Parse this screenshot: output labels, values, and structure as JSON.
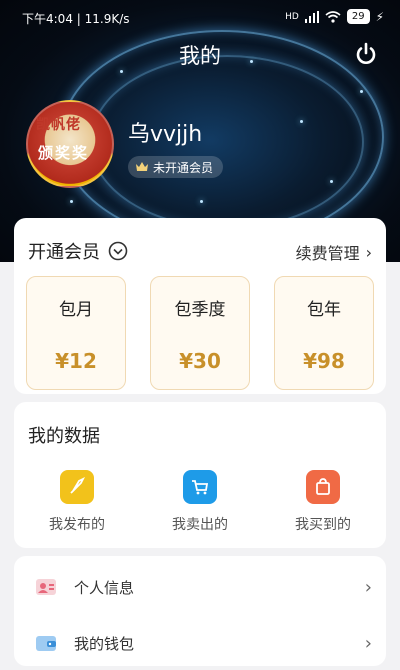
{
  "status_bar": {
    "left_text": "下午4:04 | 11.9K/s",
    "signal": "HD",
    "battery": "29"
  },
  "header": {
    "title": "我的",
    "username": "乌vvjjh",
    "membership_badge": "未开通会员",
    "avatar_text_top": "凯帆佬",
    "avatar_text_mid": "颁奖奖"
  },
  "vip": {
    "title": "开通会员",
    "manage_label": "续费管理",
    "plans": [
      {
        "name": "包月",
        "price": "¥12"
      },
      {
        "name": "包季度",
        "price": "¥30"
      },
      {
        "name": "包年",
        "price": "¥98"
      }
    ],
    "accent_color": "#c8902a"
  },
  "my_data": {
    "title": "我的数据",
    "items": [
      {
        "label": "我发布的",
        "icon": "rocket-icon",
        "color": "#f2c21b"
      },
      {
        "label": "我卖出的",
        "icon": "cart-icon",
        "color": "#1e9be8"
      },
      {
        "label": "我买到的",
        "icon": "bag-icon",
        "color": "#f06a45"
      }
    ]
  },
  "menu": {
    "items": [
      {
        "label": "个人信息",
        "icon": "profile-card-icon"
      },
      {
        "label": "我的钱包",
        "icon": "wallet-icon"
      }
    ]
  }
}
